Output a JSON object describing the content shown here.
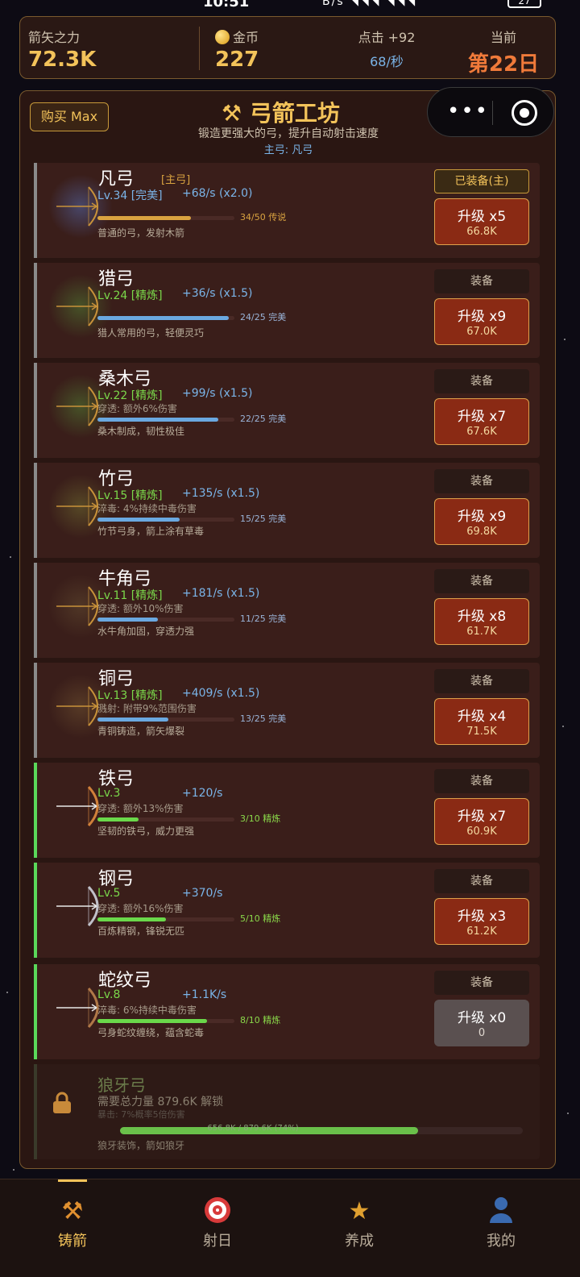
{
  "status_bar": {
    "time": "10:51",
    "net": "B/s",
    "battery": "27"
  },
  "stats": {
    "power_label": "箭矢之力",
    "power_value": "72.3K",
    "gold_label": "金币",
    "gold_value": "227",
    "click_label": "点击 +92",
    "click_rate": "68/秒",
    "day_label": "当前",
    "day_value": "第22日"
  },
  "panel": {
    "buy_max": "购买 Max",
    "title": "弓箭工坊",
    "subtitle": "锻造更强大的弓，提升自动射击速度",
    "main_bow": "主弓: 凡弓"
  },
  "bows": [
    {
      "name": "凡弓",
      "tag": "[主弓]",
      "level": "Lv.34 [完美]",
      "rate": "+68/s (x2.0)",
      "effect": "",
      "progress_text": "34/50 传说",
      "progress": 0.68,
      "desc": "普通的弓，发射木箭",
      "equip": "已装备(主)",
      "upgrade": "升级 x5",
      "cost": "66.8K"
    },
    {
      "name": "猎弓",
      "tag": "",
      "level": "Lv.24 [精炼]",
      "rate": "+36/s (x1.5)",
      "effect": "",
      "progress_text": "24/25 完美",
      "progress": 0.96,
      "desc": "猎人常用的弓，轻便灵巧",
      "equip": "装备",
      "upgrade": "升级 x9",
      "cost": "67.0K"
    },
    {
      "name": "桑木弓",
      "tag": "",
      "level": "Lv.22 [精炼]",
      "rate": "+99/s (x1.5)",
      "effect": "穿透: 额外6%伤害",
      "progress_text": "22/25 完美",
      "progress": 0.88,
      "desc": "桑木制成，韧性极佳",
      "equip": "装备",
      "upgrade": "升级 x7",
      "cost": "67.6K"
    },
    {
      "name": "竹弓",
      "tag": "",
      "level": "Lv.15 [精炼]",
      "rate": "+135/s (x1.5)",
      "effect": "淬毒: 4%持续中毒伤害",
      "progress_text": "15/25 完美",
      "progress": 0.6,
      "desc": "竹节弓身，箭上涂有草毒",
      "equip": "装备",
      "upgrade": "升级 x9",
      "cost": "69.8K"
    },
    {
      "name": "牛角弓",
      "tag": "",
      "level": "Lv.11 [精炼]",
      "rate": "+181/s (x1.5)",
      "effect": "穿透: 额外10%伤害",
      "progress_text": "11/25 完美",
      "progress": 0.44,
      "desc": "水牛角加固，穿透力强",
      "equip": "装备",
      "upgrade": "升级 x8",
      "cost": "61.7K"
    },
    {
      "name": "铜弓",
      "tag": "",
      "level": "Lv.13 [精炼]",
      "rate": "+409/s (x1.5)",
      "effect": "溅射: 附带9%范围伤害",
      "progress_text": "13/25 完美",
      "progress": 0.52,
      "desc": "青铜铸造，箭矢爆裂",
      "equip": "装备",
      "upgrade": "升级 x4",
      "cost": "71.5K"
    },
    {
      "name": "铁弓",
      "tag": "",
      "level": "Lv.3",
      "rate": "+120/s",
      "effect": "穿透: 额外13%伤害",
      "progress_text": "3/10 精炼",
      "progress": 0.3,
      "desc": "坚韧的铁弓，威力更强",
      "equip": "装备",
      "upgrade": "升级 x7",
      "cost": "60.9K"
    },
    {
      "name": "钢弓",
      "tag": "",
      "level": "Lv.5",
      "rate": "+370/s",
      "effect": "穿透: 额外16%伤害",
      "progress_text": "5/10 精炼",
      "progress": 0.5,
      "desc": "百炼精钢，锋锐无匹",
      "equip": "装备",
      "upgrade": "升级 x3",
      "cost": "61.2K"
    },
    {
      "name": "蛇纹弓",
      "tag": "",
      "level": "Lv.8",
      "rate": "+1.1K/s",
      "effect": "淬毒: 6%持续中毒伤害",
      "progress_text": "8/10 精炼",
      "progress": 0.8,
      "desc": "弓身蛇纹缠绕，蕴含蛇毒",
      "equip": "装备",
      "upgrade": "升级 x0",
      "cost": "0"
    }
  ],
  "locked": {
    "name": "狼牙弓",
    "requirement": "需要总力量 879.6K 解锁",
    "effect": "暴击: 7%概率5倍伤害",
    "progress_text": "656.8K / 879.6K (74%)",
    "progress": 0.74,
    "desc": "狼牙装饰，箭如狼牙"
  },
  "nav": [
    {
      "label": "铸箭",
      "icon": "crossed-hammers-icon",
      "active": true
    },
    {
      "label": "射日",
      "icon": "target-icon",
      "active": false
    },
    {
      "label": "养成",
      "icon": "star-icon",
      "active": false
    },
    {
      "label": "我的",
      "icon": "user-icon",
      "active": false
    }
  ],
  "colors": {
    "gold": "#f3c35a",
    "blue": "#7ab4e8",
    "green": "#7ad84a",
    "upgrade_red": "#8a2a14"
  }
}
